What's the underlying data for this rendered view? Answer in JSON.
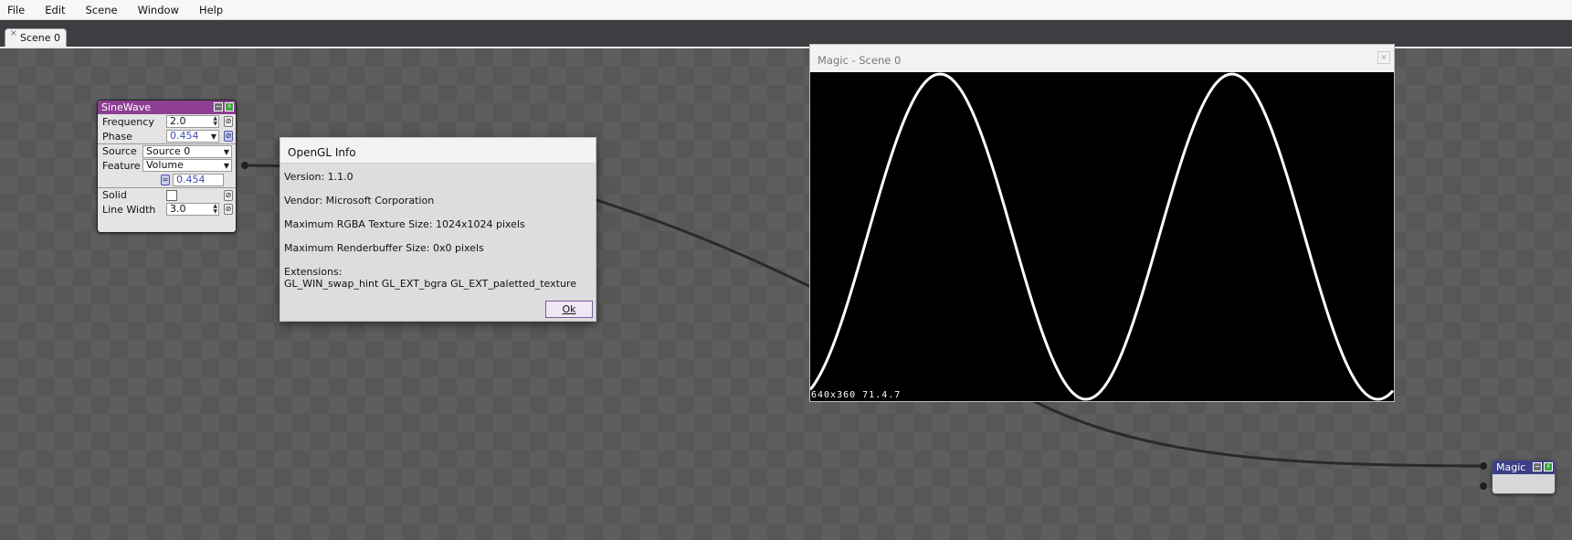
{
  "menu": [
    "File",
    "Edit",
    "Scene",
    "Window",
    "Help"
  ],
  "tab": {
    "label": "Scene 0",
    "close": "×"
  },
  "sinewave": {
    "title": "SineWave",
    "header_color": "#8e3f93",
    "frequency_label": "Frequency",
    "frequency_value": "2.0",
    "phase_label": "Phase",
    "phase_value": "0.454",
    "source_label": "Source",
    "source_value": "Source 0",
    "feature_label": "Feature",
    "feature_value": "Volume",
    "feature_output": "0.454",
    "solid_label": "Solid",
    "solid_checked": false,
    "linewidth_label": "Line Width",
    "linewidth_value": "3.0"
  },
  "opengl_dialog": {
    "title": "OpenGL Info",
    "version": "Version: 1.1.0",
    "vendor": "Vendor: Microsoft Corporation",
    "max_texture": "Maximum RGBA Texture Size: 1024x1024 pixels",
    "max_renderbuffer": "Maximum Renderbuffer Size: 0x0 pixels",
    "extensions_label": "Extensions:",
    "extensions": "GL_WIN_swap_hint GL_EXT_bgra GL_EXT_paletted_texture",
    "ok_label": "Ok"
  },
  "preview": {
    "title": "Magic - Scene 0",
    "close": "×",
    "resolution": "640x360 71.4.7",
    "wave_color": "#ffffff",
    "background_color": "#000000"
  },
  "magic_node": {
    "title": "Magic",
    "header_color": "#3c3f86"
  },
  "wire_color": "#2a2a2a"
}
